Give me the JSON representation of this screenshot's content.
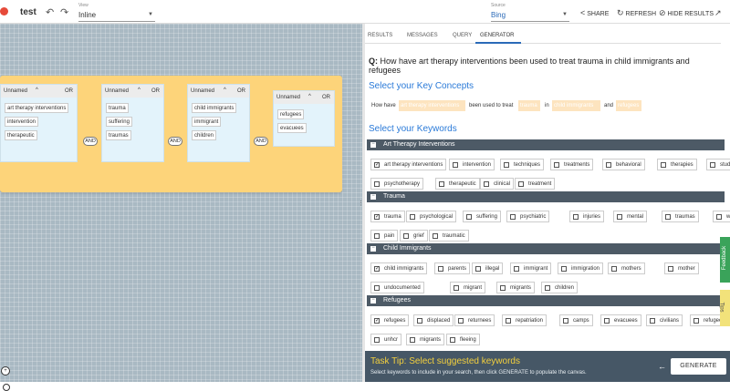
{
  "app": {
    "title": "test"
  },
  "view": {
    "label": "View",
    "value": "Inline"
  },
  "source": {
    "label": "Source",
    "value": "Bing"
  },
  "toolbar": {
    "share": "SHARE",
    "refresh": "REFRESH",
    "hide_results": "HIDE RESULTS"
  },
  "canvas": {
    "groups": [
      {
        "name": "Unnamed",
        "op": "OR",
        "terms": [
          "art therapy interventions",
          "intervention",
          "therapeutic"
        ]
      },
      {
        "name": "Unnamed",
        "op": "OR",
        "terms": [
          "trauma",
          "suffering",
          "traumas"
        ]
      },
      {
        "name": "Unnamed",
        "op": "OR",
        "terms": [
          "child immigrants",
          "immigrant",
          "children"
        ]
      },
      {
        "name": "Unnamed",
        "op": "OR",
        "terms": [
          "refugees",
          "evacuees"
        ]
      }
    ],
    "and_label": "AND"
  },
  "tabs": [
    "RESULTS",
    "MESSAGES",
    "QUERY",
    "GENERATOR"
  ],
  "active_tab": "GENERATOR",
  "question": {
    "prefix": "Q:",
    "text": "How have art therapy interventions been used to treat trauma in child immigrants and refugees"
  },
  "key_concepts": {
    "heading": "Select your Key Concepts",
    "parts": [
      "How have",
      "art therapy interventions",
      "been used to treat",
      "trauma",
      "in",
      "child immigrants",
      "and",
      "refugees"
    ]
  },
  "keywords": {
    "heading": "Select your Keywords",
    "sections": [
      {
        "name": "Art Therapy Interventions",
        "rows": [
          [
            {
              "t": "art therapy interventions",
              "c": true
            },
            {
              "t": "intervention",
              "c": false
            },
            {
              "t": "techniques",
              "c": false
            },
            {
              "t": "treatments",
              "c": false
            },
            {
              "t": "behavioral",
              "c": false
            },
            {
              "t": "therapies",
              "c": false
            },
            {
              "t": "studies",
              "c": false
            }
          ],
          [
            {
              "t": "psychotherapy",
              "c": false
            },
            {
              "t": "therapeutic",
              "c": false
            },
            {
              "t": "clinical",
              "c": false
            },
            {
              "t": "treatment",
              "c": false
            }
          ]
        ]
      },
      {
        "name": "Trauma",
        "rows": [
          [
            {
              "t": "trauma",
              "c": true
            },
            {
              "t": "psychological",
              "c": false
            },
            {
              "t": "suffering",
              "c": false
            },
            {
              "t": "psychiatric",
              "c": false
            },
            {
              "t": "injuries",
              "c": false
            },
            {
              "t": "mental",
              "c": false
            },
            {
              "t": "traumas",
              "c": false
            },
            {
              "t": "wounds",
              "c": false
            }
          ],
          [
            {
              "t": "pain",
              "c": false
            },
            {
              "t": "grief",
              "c": false
            },
            {
              "t": "traumatic",
              "c": false
            }
          ]
        ]
      },
      {
        "name": "Child Immigrants",
        "rows": [
          [
            {
              "t": "child immigrants",
              "c": true
            },
            {
              "t": "parents",
              "c": false
            },
            {
              "t": "illegal",
              "c": false
            },
            {
              "t": "immigrant",
              "c": false
            },
            {
              "t": "immigration",
              "c": false
            },
            {
              "t": "mothers",
              "c": false
            },
            {
              "t": "mother",
              "c": false
            }
          ],
          [
            {
              "t": "undocumented",
              "c": false
            },
            {
              "t": "migrant",
              "c": false
            },
            {
              "t": "migrants",
              "c": false
            },
            {
              "t": "children",
              "c": false
            }
          ]
        ]
      },
      {
        "name": "Refugees",
        "rows": [
          [
            {
              "t": "refugees",
              "c": true
            },
            {
              "t": "displaced",
              "c": false
            },
            {
              "t": "returnees",
              "c": false
            },
            {
              "t": "repatriation",
              "c": false
            },
            {
              "t": "camps",
              "c": false
            },
            {
              "t": "evacuees",
              "c": false
            },
            {
              "t": "civilians",
              "c": false
            },
            {
              "t": "refugee",
              "c": false
            }
          ],
          [
            {
              "t": "unhcr",
              "c": false
            },
            {
              "t": "migrants",
              "c": false
            },
            {
              "t": "fleeing",
              "c": false
            }
          ]
        ]
      }
    ]
  },
  "task_tip": {
    "title": "Task Tip: Select suggested keywords",
    "subtitle": "Select keywords to include in your search, then click GENERATE to populate the canvas."
  },
  "generate_label": "GENERATE",
  "side": {
    "feedback": "Feedback",
    "tips": "Tips"
  },
  "colors": {
    "accent": "#2a6ab8",
    "board": "#fdd47a",
    "group": "#e3f3fb",
    "section": "#4d5a66",
    "tipbar": "#465766",
    "tip_title": "#f3d03e",
    "concept_blank": "#fde4bf",
    "feedback": "#3aa35a"
  }
}
